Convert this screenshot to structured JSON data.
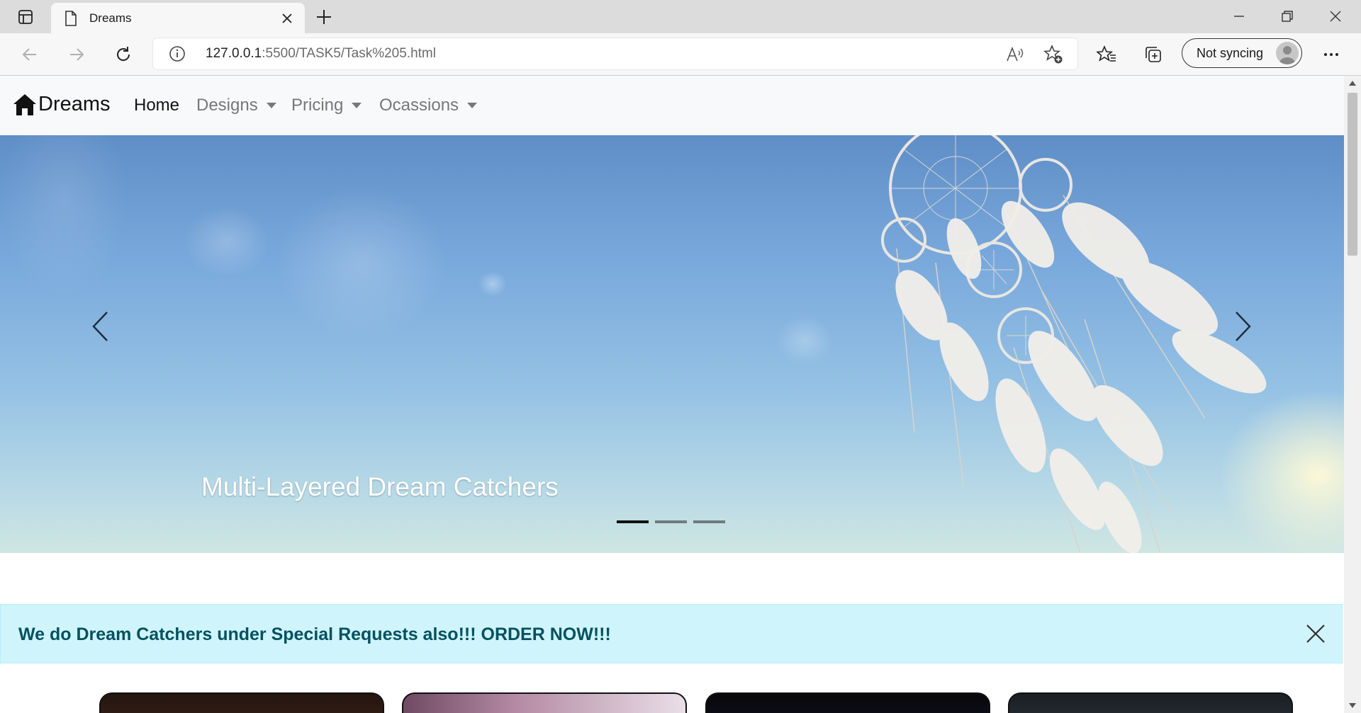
{
  "browser": {
    "tab": {
      "title": "Dreams"
    },
    "address": {
      "host": "127.0.0.1",
      "path": ":5500/TASK5/Task%205.html"
    },
    "profile": {
      "label": "Not syncing"
    }
  },
  "site": {
    "brand": "Dreams",
    "nav": [
      {
        "label": "Home"
      },
      {
        "label": "Designs"
      },
      {
        "label": "Pricing"
      },
      {
        "label": "Ocassions"
      }
    ],
    "carousel": {
      "caption": "Multi-Layered Dream Catchers",
      "active_slide": 1,
      "slide_count": 3
    },
    "alert": {
      "message": "We do Dream Catchers under Special Requests also!!! ORDER NOW!!!"
    }
  },
  "colors": {
    "navbar_bg": "#f8f9fa",
    "alert_bg": "#cff4fc",
    "alert_text": "#055160"
  }
}
